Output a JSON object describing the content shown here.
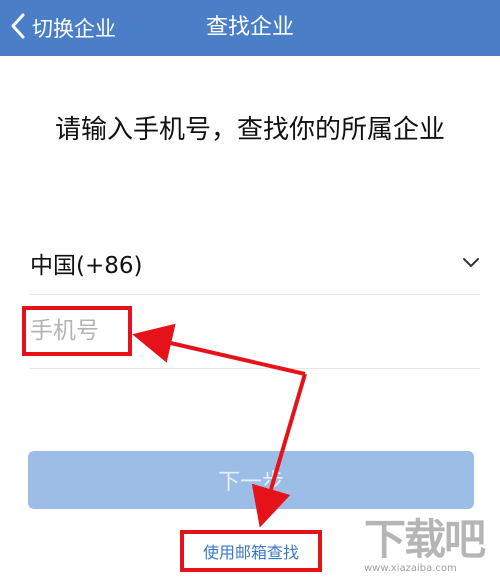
{
  "navbar": {
    "back_label": "切换企业",
    "title": "查找企业"
  },
  "prompt": "请输入手机号，查找你的所属企业",
  "country": {
    "label": "中国(+86)"
  },
  "phone": {
    "placeholder": "手机号",
    "value": ""
  },
  "next_button": {
    "label": "下一步"
  },
  "email_link": {
    "label": "使用邮箱查找"
  },
  "watermark": {
    "logo_text": "下载吧",
    "url": "www.xiazaiba.com"
  },
  "colors": {
    "navbar": "#4a7fc7",
    "button_disabled": "#9cbde5",
    "link": "#3a79c9",
    "annotation": "#e5121a"
  }
}
